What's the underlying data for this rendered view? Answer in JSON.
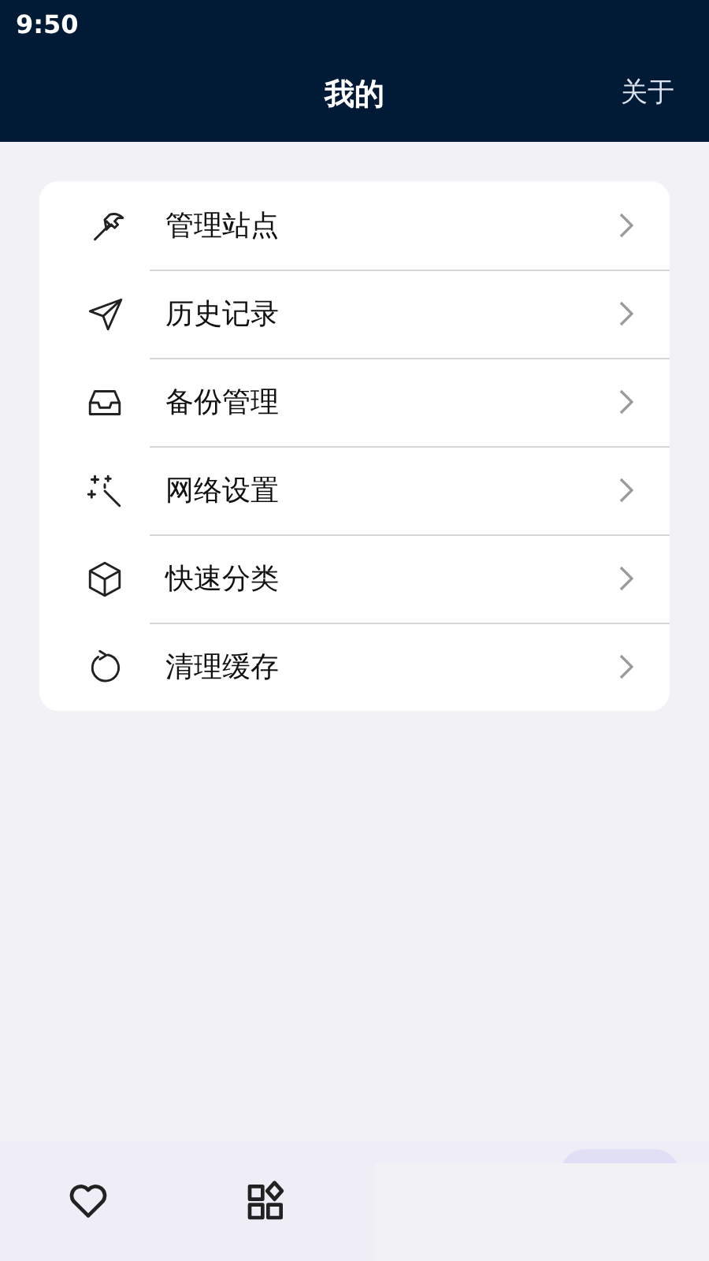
{
  "status_bar": {
    "time": "9:50"
  },
  "header": {
    "title": "我的",
    "action": "关于"
  },
  "menu": [
    {
      "label": "管理站点"
    },
    {
      "label": "历史记录"
    },
    {
      "label": "备份管理"
    },
    {
      "label": "网络设置"
    },
    {
      "label": "快速分类"
    },
    {
      "label": "清理缓存"
    }
  ]
}
